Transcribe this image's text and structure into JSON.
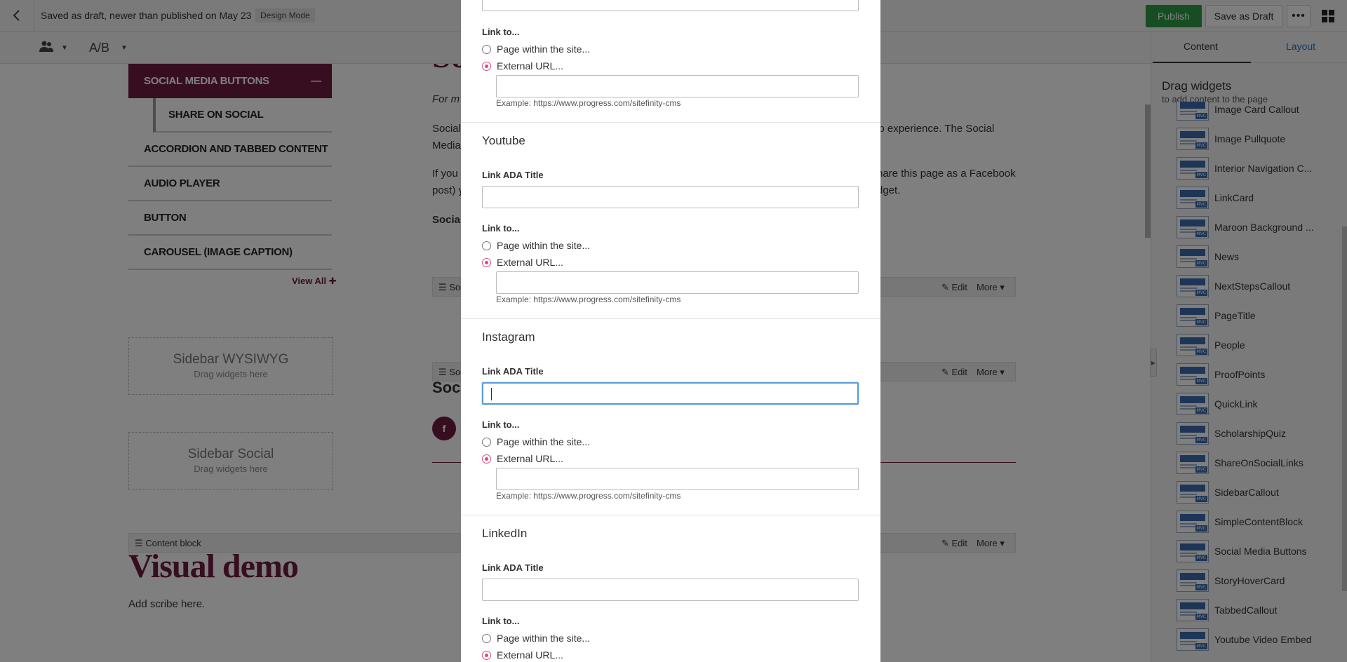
{
  "topbar": {
    "status": "Saved as draft, newer than published on May 23",
    "mode": "Design Mode",
    "publish_label": "Publish",
    "save_draft_label": "Save as Draft",
    "more_label": "•••"
  },
  "toolbar": {
    "ab_label": "A/B"
  },
  "right_panel": {
    "tabs": [
      "Content",
      "Layout"
    ],
    "title": "Drag widgets",
    "subtitle": "to add content to the page",
    "widgets": [
      "Image Card Callout",
      "Image Pullquote",
      "Interior Navigation C...",
      "LinkCard",
      "Maroon Background ...",
      "News",
      "NextStepsCallout",
      "PageTitle",
      "People",
      "ProofPoints",
      "QuickLink",
      "ScholarshipQuiz",
      "ShareOnSocialLinks",
      "SidebarCallout",
      "SimpleContentBlock",
      "Social Media Buttons",
      "StoryHoverCard",
      "TabbedCallout",
      "Youtube Video Embed"
    ],
    "widget_tag": "MVC"
  },
  "canvas": {
    "nav": {
      "active": "SOCIAL MEDIA BUTTONS",
      "active_icon": "—",
      "sub": "SHARE ON SOCIAL",
      "items": [
        "ACCORDION AND TABBED CONTENT",
        "AUDIO PLAYER",
        "BUTTON",
        "CAROUSEL (IMAGE CAPTION)"
      ],
      "view_all": "View All"
    },
    "dropzones": [
      {
        "title": "Sidebar WYSIWYG",
        "sub": "Drag widgets here"
      },
      {
        "title": "Sidebar Social",
        "sub": "Drag widgets here"
      }
    ],
    "widget_bars": {
      "edit": "Edit",
      "more": "More",
      "bar1_label": "Soc",
      "bar2_label": "Soc",
      "content_block": "Content block"
    },
    "text": {
      "heading_partial": "So",
      "italic_line": "For m",
      "p1_left": "Social",
      "p1_right": "eb experience. The Social",
      "p1_left2": "Media",
      "p2_left": "If you",
      "p2_right": "hare this page as a Facebook",
      "p2_left2": "post) y",
      "p2_right2": "dget.",
      "bold_line": "Social",
      "soci_heading": "Soci",
      "fb_letter": "f"
    },
    "visual_demo": "Visual demo",
    "add_scribe": "Add scribe here."
  },
  "modal": {
    "link_to": "Link to...",
    "page_within": "Page within the site...",
    "external_url": "External URL...",
    "example": "Example: https://www.progress.com/sitefinity-cms",
    "ada_title": "Link ADA Title",
    "sections": [
      "Youtube",
      "Instagram",
      "LinkedIn"
    ]
  },
  "colors": {
    "brand_maroon": "#6d1d40",
    "publish_green": "#2e9b46",
    "radio_pink": "#d14f86",
    "focus_blue": "#5b9bd5",
    "link_blue": "#1a73c6"
  }
}
